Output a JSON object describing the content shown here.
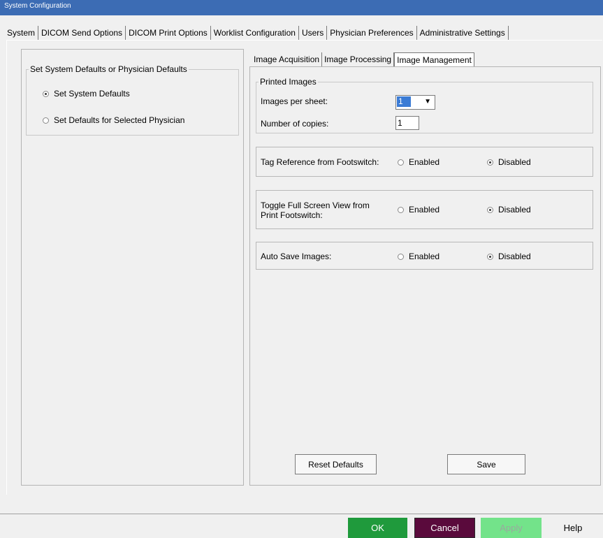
{
  "window": {
    "title": "System Configuration"
  },
  "main_tabs": [
    {
      "label": "System"
    },
    {
      "label": "DICOM Send Options"
    },
    {
      "label": "DICOM Print Options"
    },
    {
      "label": "Worklist Configuration"
    },
    {
      "label": "Users"
    },
    {
      "label": "Physician Preferences",
      "active": true
    },
    {
      "label": "Administrative Settings"
    }
  ],
  "left_panel": {
    "group_title": "Set System Defaults or Physician Defaults",
    "options": [
      {
        "label": "Set System Defaults",
        "selected": true
      },
      {
        "label": "Set Defaults for Selected Physician",
        "selected": false
      }
    ]
  },
  "sub_tabs": [
    {
      "label": "Image Acquisition"
    },
    {
      "label": "Image Processing"
    },
    {
      "label": "Image Management",
      "active": true
    }
  ],
  "printed_images": {
    "title": "Printed Images",
    "images_per_sheet_label": "Images per sheet:",
    "images_per_sheet_value": "1",
    "copies_label": "Number of copies:",
    "copies_value": "1"
  },
  "settings": [
    {
      "label": "Tag Reference from Footswitch:",
      "enabled_label": "Enabled",
      "disabled_label": "Disabled",
      "value": "Disabled"
    },
    {
      "label": "Toggle Full Screen View from Print Footswitch:",
      "enabled_label": "Enabled",
      "disabled_label": "Disabled",
      "value": "Disabled"
    },
    {
      "label": "Auto Save Images:",
      "enabled_label": "Enabled",
      "disabled_label": "Disabled",
      "value": "Disabled"
    }
  ],
  "panel_buttons": {
    "reset_label": "Reset Defaults",
    "save_label": "Save"
  },
  "footer": {
    "ok_label": "OK",
    "cancel_label": "Cancel",
    "apply_label": "Apply",
    "help_label": "Help"
  },
  "colors": {
    "ok_bg": "#1f9a3c",
    "cancel_bg": "#5a0a3c",
    "apply_bg": "#73e38a",
    "title_bar": "#3c6cb4"
  }
}
